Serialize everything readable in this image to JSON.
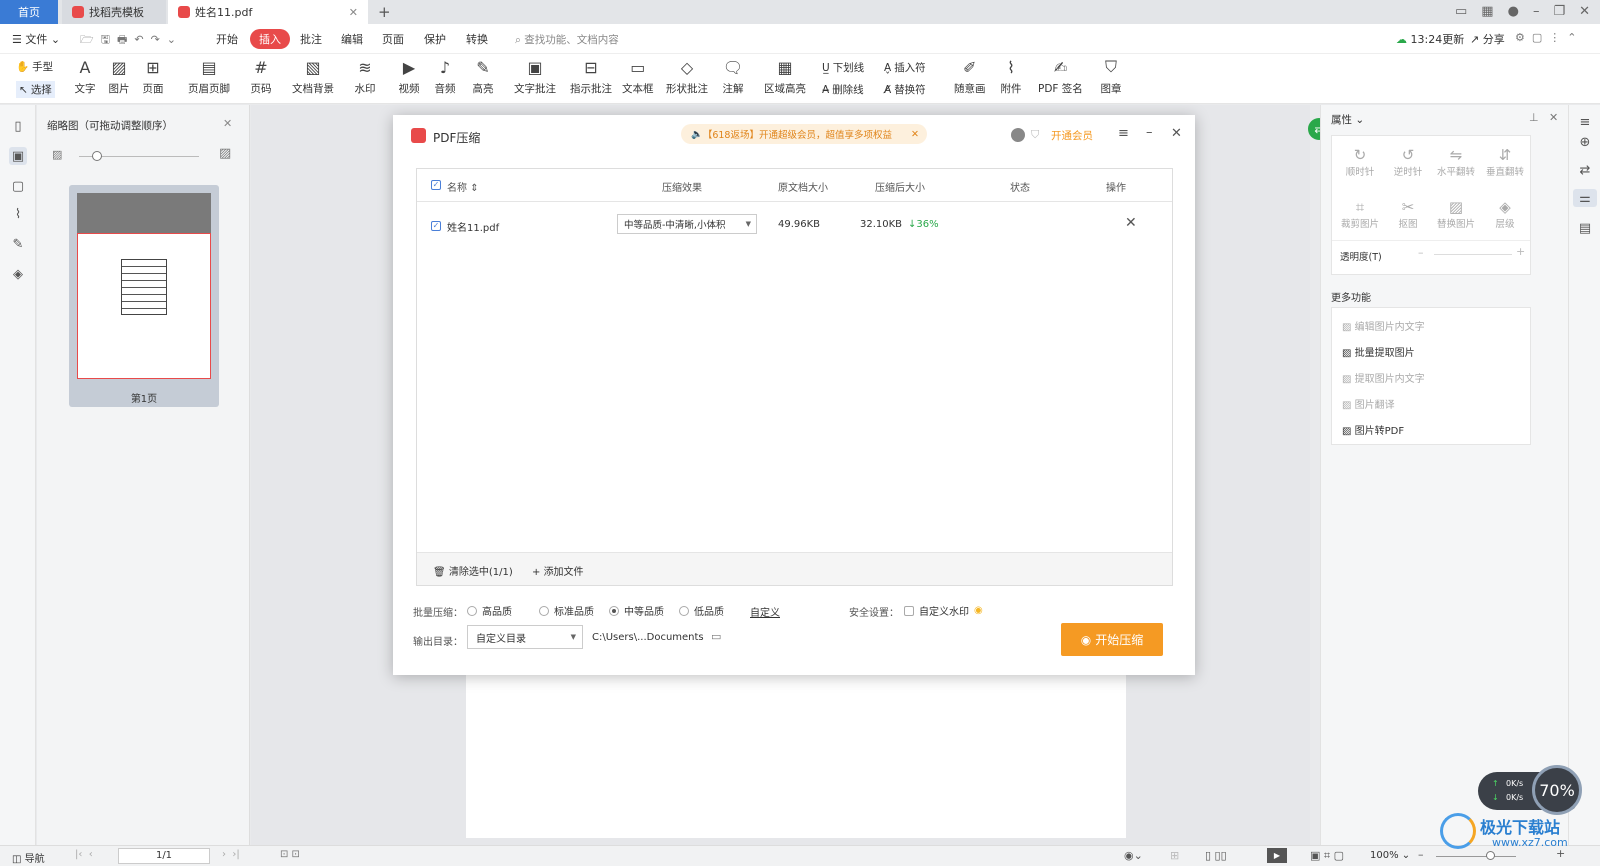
{
  "tabs": {
    "home": "首页",
    "templates": "找稻壳模板",
    "file": "姓名11.pdf",
    "new_tab": "+"
  },
  "menubar": {
    "file": "文件",
    "start": "开始",
    "insert": "插入",
    "annotate": "批注",
    "edit": "编辑",
    "page": "页面",
    "protect": "保护",
    "convert": "转换",
    "search_placeholder": "查找功能、文档内容",
    "update": "13:24更新",
    "share": "分享"
  },
  "ribbon": {
    "hand": "手型",
    "select": "选择",
    "text": "文字",
    "image": "图片",
    "page": "页面",
    "header_footer": "页眉页脚",
    "page_number": "页码",
    "doc_bg": "文档背景",
    "watermark": "水印",
    "video": "视频",
    "audio": "音频",
    "highlight": "高亮",
    "text_annotation": "文字批注",
    "pointer_annotation": "指示批注",
    "textbox": "文本框",
    "shape_annotation": "形状批注",
    "note": "注解",
    "area_highlight": "区域高亮",
    "underline": "下划线",
    "strikethrough": "删除线",
    "insert_mark": "插入符",
    "replace_mark": "替换符",
    "freehand": "随意画",
    "attachment": "附件",
    "pdf_sign": "PDF 签名",
    "stamp": "图章"
  },
  "thumb": {
    "title": "缩略图（可拖动调整顺序）",
    "page_label": "第1页"
  },
  "dialog": {
    "title": "PDF压缩",
    "promo": "【618返场】开通超级会员，超值享多项权益",
    "vip": "开通会员",
    "headers": {
      "name": "名称",
      "effect": "压缩效果",
      "original": "原文档大小",
      "compressed": "压缩后大小",
      "status": "状态",
      "action": "操作"
    },
    "row": {
      "name": "姓名11.pdf",
      "effect": "中等品质-中清晰,小体积",
      "original": "49.96KB",
      "compressed": "32.10KB",
      "ratio": "↓36%"
    },
    "clear": "清除选中(1/1)",
    "add": "添加文件",
    "batch_label": "批量压缩：",
    "opt_high": "高品质",
    "opt_std": "标准品质",
    "opt_mid": "中等品质",
    "opt_low": "低品质",
    "custom": "自定义",
    "security_label": "安全设置：",
    "custom_watermark": "自定义水印",
    "output_label": "输出目录：",
    "output_select": "自定义目录",
    "output_path": "C:\\Users\\...Documents",
    "start_btn": "开始压缩"
  },
  "right": {
    "props": "属性",
    "clockwise": "顺时针",
    "counter": "逆时针",
    "flip_h": "水平翻转",
    "flip_v": "垂直翻转",
    "crop": "裁剪图片",
    "cutout": "抠图",
    "replace": "替换图片",
    "layer": "层级",
    "opacity": "透明度(T)",
    "more": "更多功能",
    "edit_text": "编辑图片内文字",
    "batch_extract": "批量提取图片",
    "extract_text": "提取图片内文字",
    "translate": "图片翻译",
    "to_pdf": "图片转PDF"
  },
  "statusbar": {
    "nav": "导航",
    "page": "1/1",
    "zoom": "100%"
  },
  "widget": {
    "up": "0K/s",
    "down": "0K/s",
    "pct": "70%"
  },
  "watermark_site": "极光下载站",
  "watermark_url": "www.xz7.com",
  "colors": {
    "accent": "#f59a23",
    "brand_red": "#e84a4a",
    "blue": "#4a7fd8"
  }
}
